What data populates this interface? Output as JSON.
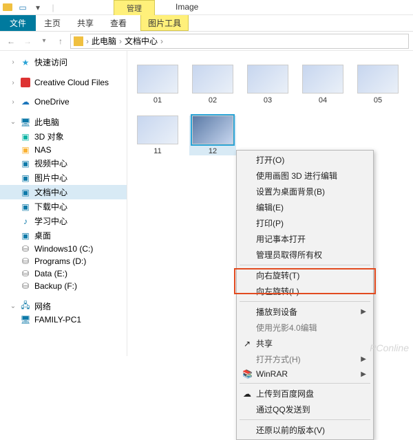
{
  "titlebar": {
    "tool_tab": "管理",
    "title": "Image"
  },
  "ribbon": {
    "file": "文件",
    "home": "主页",
    "share": "共享",
    "view": "查看",
    "pic_tools": "图片工具"
  },
  "breadcrumb": {
    "root": "此电脑",
    "folder": "文档中心"
  },
  "sidebar": {
    "quick": "快速访问",
    "creative": "Creative Cloud Files",
    "onedrive": "OneDrive",
    "pc": "此电脑",
    "pc_items": [
      "3D 对象",
      "NAS",
      "视频中心",
      "图片中心",
      "文档中心",
      "下载中心",
      "学习中心",
      "桌面",
      "Windows10 (C:)",
      "Programs (D:)",
      "Data (E:)",
      "Backup (F:)"
    ],
    "network": "网络",
    "host": "FAMILY-PC1"
  },
  "thumbs": [
    "01",
    "02",
    "03",
    "04",
    "05",
    "11",
    "12"
  ],
  "selected_thumb_index": 6,
  "ctx": {
    "items": [
      {
        "label": "打开(O)"
      },
      {
        "label": "使用画图 3D 进行编辑"
      },
      {
        "label": "设置为桌面背景(B)"
      },
      {
        "label": "编辑(E)"
      },
      {
        "label": "打印(P)"
      },
      {
        "label": "用记事本打开"
      },
      {
        "label": "管理员取得所有权"
      },
      {
        "sep": true
      },
      {
        "label": "向右旋转(T)"
      },
      {
        "label": "向左旋转(L)"
      },
      {
        "sep": true
      },
      {
        "label": "播放到设备",
        "sub": true
      },
      {
        "label": "使用光影4.0编辑",
        "dim": true
      },
      {
        "label": "共享",
        "icon": "share"
      },
      {
        "label": "打开方式(H)",
        "sub": true,
        "dim": true
      },
      {
        "label": "WinRAR",
        "icon": "winrar",
        "sub": true
      },
      {
        "sep": true
      },
      {
        "label": "上传到百度网盘",
        "icon": "baidu"
      },
      {
        "label": "通过QQ发送到"
      },
      {
        "sep": true
      },
      {
        "label": "还原以前的版本(V)"
      }
    ]
  },
  "watermark": "PConline"
}
